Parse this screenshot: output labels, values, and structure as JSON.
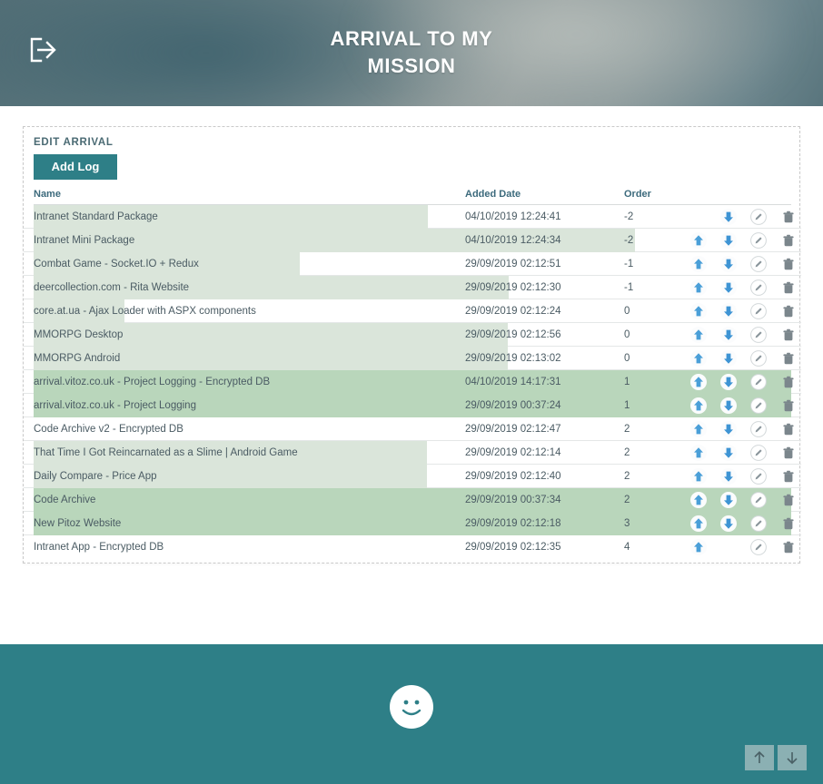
{
  "header": {
    "title_line1": "ARRIVAL TO MY",
    "title_line2": "MISSION",
    "logout_icon": "logout-icon"
  },
  "card": {
    "title": "EDIT ARRIVAL",
    "add_log_label": "Add Log"
  },
  "table": {
    "columns": {
      "name": "Name",
      "added_date": "Added Date",
      "order": "Order"
    },
    "action_icons": {
      "up": "arrow-up-icon",
      "down": "arrow-down-icon",
      "edit": "pencil-icon",
      "delete": "trash-icon"
    },
    "rows": [
      {
        "name": "Intranet Standard Package",
        "added_date": "04/10/2019 12:24:41",
        "order": "-2",
        "fill_width": 434,
        "dark": false,
        "has_up": false,
        "has_down": true
      },
      {
        "name": "Intranet Mini Package",
        "added_date": "04/10/2019 12:24:34",
        "order": "-2",
        "fill_width": 662,
        "dark": false,
        "has_up": true,
        "has_down": true
      },
      {
        "name": "Combat Game - Socket.IO + Redux",
        "added_date": "29/09/2019 02:12:51",
        "order": "-1",
        "fill_width": 293,
        "dark": false,
        "has_up": true,
        "has_down": true
      },
      {
        "name": "deercollection.com - Rita Website",
        "added_date": "29/09/2019 02:12:30",
        "order": "-1",
        "fill_width": 523,
        "dark": false,
        "has_up": true,
        "has_down": true
      },
      {
        "name": "core.at.ua - Ajax Loader with ASPX components",
        "added_date": "29/09/2019 02:12:24",
        "order": "0",
        "fill_width": 100,
        "dark": false,
        "has_up": true,
        "has_down": true
      },
      {
        "name": "MMORPG Desktop",
        "added_date": "29/09/2019 02:12:56",
        "order": "0",
        "fill_width": 522,
        "dark": false,
        "has_up": true,
        "has_down": true
      },
      {
        "name": "MMORPG Android",
        "added_date": "29/09/2019 02:13:02",
        "order": "0",
        "fill_width": 522,
        "dark": false,
        "has_up": true,
        "has_down": true
      },
      {
        "name": "arrival.vitoz.co.uk - Project Logging - Encrypted DB",
        "added_date": "04/10/2019 14:17:31",
        "order": "1",
        "fill_width": 834,
        "dark": true,
        "has_up": true,
        "has_down": true
      },
      {
        "name": "arrival.vitoz.co.uk - Project Logging",
        "added_date": "29/09/2019 00:37:24",
        "order": "1",
        "fill_width": 834,
        "dark": true,
        "has_up": true,
        "has_down": true
      },
      {
        "name": "Code Archive v2 - Encrypted DB",
        "added_date": "29/09/2019 02:12:47",
        "order": "2",
        "fill_width": 0,
        "dark": false,
        "has_up": true,
        "has_down": true
      },
      {
        "name": "That Time I Got Reincarnated as a Slime | Android Game",
        "added_date": "29/09/2019 02:12:14",
        "order": "2",
        "fill_width": 433,
        "dark": false,
        "has_up": true,
        "has_down": true
      },
      {
        "name": "Daily Compare - Price App",
        "added_date": "29/09/2019 02:12:40",
        "order": "2",
        "fill_width": 433,
        "dark": false,
        "has_up": true,
        "has_down": true
      },
      {
        "name": "Code Archive",
        "added_date": "29/09/2019 00:37:34",
        "order": "2",
        "fill_width": 834,
        "dark": true,
        "has_up": true,
        "has_down": true
      },
      {
        "name": "New Pitoz Website",
        "added_date": "29/09/2019 02:12:18",
        "order": "3",
        "fill_width": 834,
        "dark": true,
        "has_up": true,
        "has_down": true
      },
      {
        "name": "Intranet App - Encrypted DB",
        "added_date": "29/09/2019 02:12:35",
        "order": "4",
        "fill_width": 0,
        "dark": false,
        "has_up": true,
        "has_down": false
      }
    ]
  },
  "footer": {
    "smiley_icon": "smiley-face-icon",
    "scroll_up_icon": "scroll-up-icon",
    "scroll_down_icon": "scroll-down-icon"
  },
  "colors": {
    "teal": "#2e7f87",
    "row_light_green": "#dae5da",
    "row_dark_green": "#b9d6bb",
    "arrow_blue": "#4a9fd8",
    "icon_gray": "#7b868c"
  }
}
